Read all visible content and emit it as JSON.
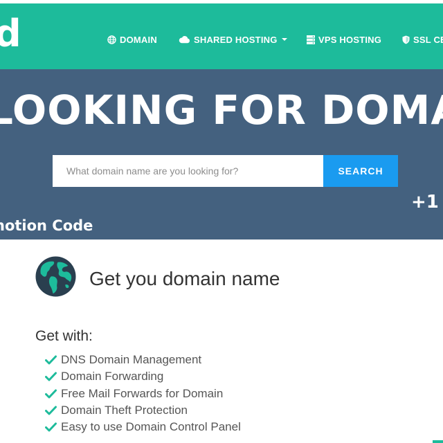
{
  "header": {
    "logo_text": "d",
    "nav": [
      {
        "label": "DOMAIN",
        "icon": "globe-icon"
      },
      {
        "label": "SHARED HOSTING",
        "icon": "cloud-icon",
        "has_dropdown": true
      },
      {
        "label": "VPS HOSTING",
        "icon": "server-icon"
      },
      {
        "label": "SSL CE",
        "icon": "shield-icon"
      }
    ]
  },
  "hero": {
    "title": "LOOKING FOR DOMAIN",
    "search": {
      "placeholder": "What domain name are you looking for?",
      "value": "",
      "button_label": "SEARCH"
    },
    "plus_text": "+1",
    "promo_text": "notion Code"
  },
  "content": {
    "title": "Get you domain name",
    "icon": "earth-globe-icon",
    "get_with_label": "Get with:",
    "features": [
      "DNS Domain Management",
      "Domain Forwarding",
      "Free Mail Forwards for Domain",
      "Domain Theft Protection",
      "Easy to use Domain Control Panel"
    ]
  },
  "colors": {
    "header_bg": "#1dbb9b",
    "hero_bg": "#44617f",
    "search_button_bg": "#1a9bf0",
    "check_color": "#1dbb9b"
  }
}
